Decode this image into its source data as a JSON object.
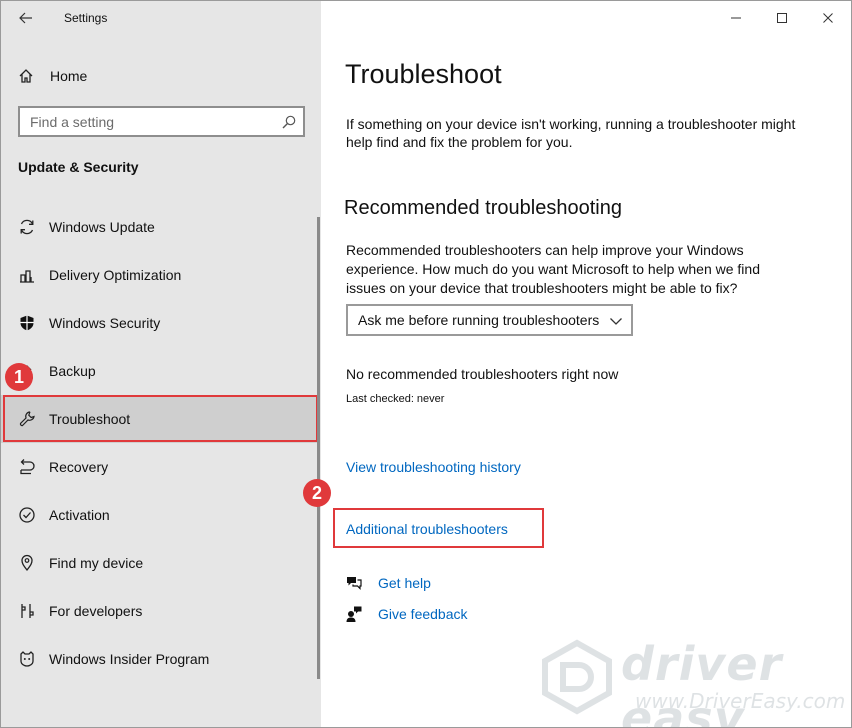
{
  "window": {
    "title": "Settings"
  },
  "sidebar": {
    "home_label": "Home",
    "search_placeholder": "Find a setting",
    "section_title": "Update & Security",
    "items": [
      {
        "label": "Windows Update",
        "icon": "sync-icon"
      },
      {
        "label": "Delivery Optimization",
        "icon": "delivery-optimization-icon"
      },
      {
        "label": "Windows Security",
        "icon": "shield-icon"
      },
      {
        "label": "Backup",
        "icon": "backup-icon"
      },
      {
        "label": "Troubleshoot",
        "icon": "wrench-icon",
        "selected": true
      },
      {
        "label": "Recovery",
        "icon": "recovery-icon"
      },
      {
        "label": "Activation",
        "icon": "checkmark-circle-icon"
      },
      {
        "label": "Find my device",
        "icon": "find-device-icon"
      },
      {
        "label": "For developers",
        "icon": "developer-tools-icon"
      },
      {
        "label": "Windows Insider Program",
        "icon": "insider-icon"
      }
    ]
  },
  "main": {
    "title": "Troubleshoot",
    "intro": "If something on your device isn't working, running a troubleshooter might help find and fix the problem for you.",
    "recommended": {
      "heading": "Recommended troubleshooting",
      "description": "Recommended troubleshooters can help improve your Windows experience. How much do you want Microsoft to help when we find issues on your device that troubleshooters might be able to fix?",
      "dropdown_value": "Ask me before running troubleshooters",
      "status": "No recommended troubleshooters right now",
      "last_checked": "Last checked: never"
    },
    "history_link": "View troubleshooting history",
    "additional_link": "Additional troubleshooters",
    "get_help": "Get help",
    "give_feedback": "Give feedback"
  },
  "annotations": {
    "step1": "1",
    "step2": "2"
  },
  "watermark": {
    "brand": "driver easy",
    "url": "www.DriverEasy.com"
  },
  "colors": {
    "accent_link": "#0067c0",
    "annotation_red": "#e0393b",
    "sidebar_bg": "#e6e6e6",
    "selected_bg": "#cfcfcf"
  }
}
